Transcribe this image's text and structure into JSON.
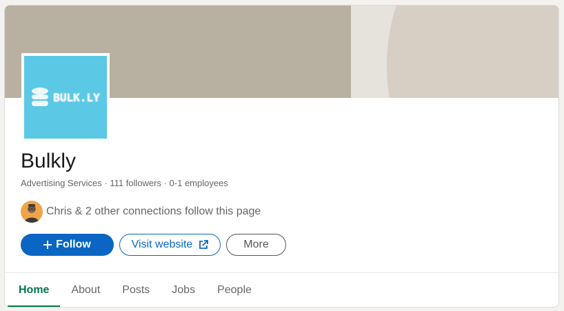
{
  "company": {
    "name": "Bulkly",
    "logo_text": "BULK.LY",
    "meta": "Advertising Services · 111 followers · 0-1 employees",
    "connections_text": "Chris & 2 other connections follow this page"
  },
  "actions": {
    "follow_label": "Follow",
    "website_label": "Visit website",
    "more_label": "More"
  },
  "tabs": [
    {
      "label": "Home",
      "active": true
    },
    {
      "label": "About"
    },
    {
      "label": "Posts"
    },
    {
      "label": "Jobs"
    },
    {
      "label": "People"
    }
  ],
  "colors": {
    "brand": "#0a66c2",
    "active_tab": "#01754f",
    "logo_bg": "#5bc8e5"
  }
}
